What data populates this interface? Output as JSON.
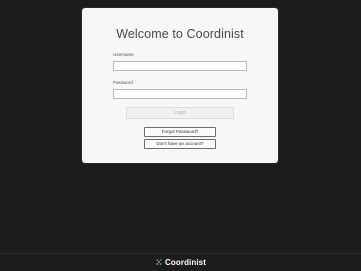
{
  "card": {
    "title": "Welcome to Coordinist",
    "username_label": "Username",
    "username_value": "",
    "password_label": "Password",
    "password_value": "",
    "login_label": "Login",
    "forgot_password_label": "Forgot Password?",
    "no_account_label": "Don't have an account?"
  },
  "footer": {
    "brand": "Coordinist",
    "logo_icon": "coordinist-logo-icon"
  },
  "colors": {
    "background": "#1c1c1c",
    "card": "#f7f7f7",
    "logo_accent": "#3fb89a"
  }
}
